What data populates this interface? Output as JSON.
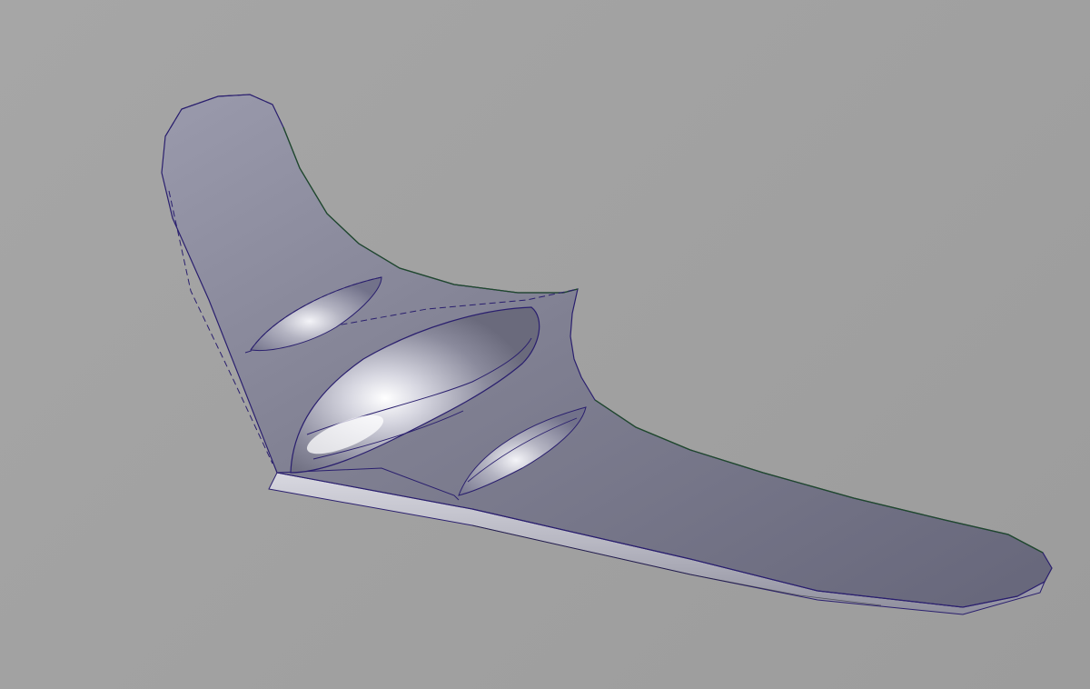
{
  "viewport": {
    "background": "#a3a3a3",
    "subject": "flying-wing-cad-model"
  },
  "colors": {
    "surface_light": "#9595a8",
    "surface_mid": "#77778a",
    "surface_dark": "#5f5f70",
    "edge_line": "#2a1f6e",
    "trailing_edge_line": "#1f4a2a",
    "highlight": "#ffffff"
  }
}
